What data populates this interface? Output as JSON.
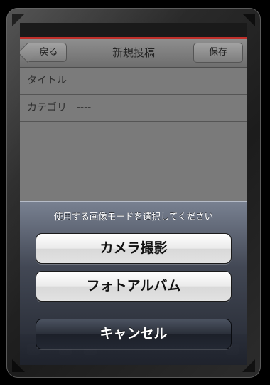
{
  "nav": {
    "back_label": "戻る",
    "title": "新規投稿",
    "save_label": "保存"
  },
  "form": {
    "title_label": "タイトル",
    "category_label": "カテゴリ",
    "category_value": "----"
  },
  "action_sheet": {
    "message": "使用する画像モードを選択してください",
    "camera_label": "カメラ撮影",
    "album_label": "フォトアルバム",
    "cancel_label": "キャンセル"
  },
  "colors": {
    "status_accent": "#c0302b"
  }
}
